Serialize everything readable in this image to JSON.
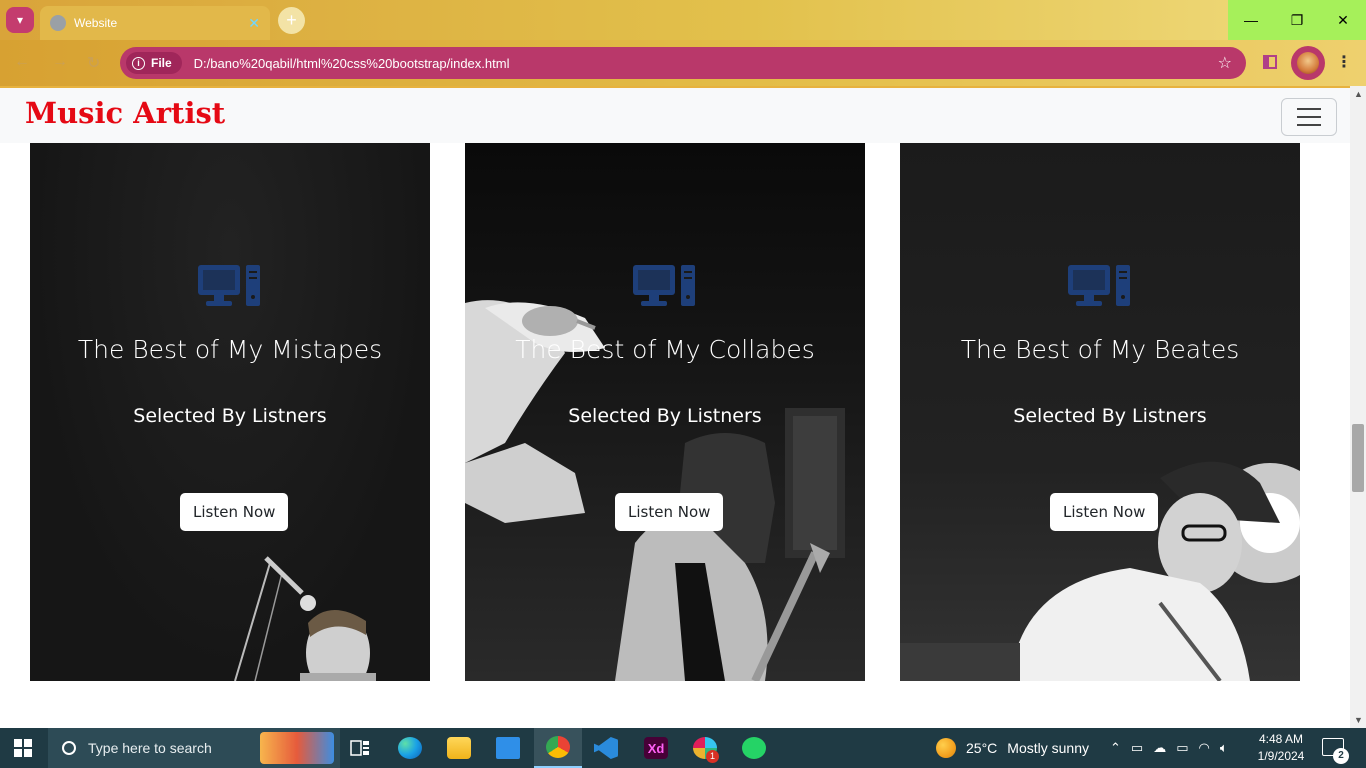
{
  "browser": {
    "tab_title": "Website",
    "tab_close": "✕",
    "new_tab": "+",
    "address_chip": "File",
    "url": "D:/bano%20qabil/html%20css%20bootstrap/index.html",
    "window_controls": {
      "minimize": "—",
      "restore": "❐",
      "close": "✕"
    },
    "nav_icons": [
      "back-icon",
      "forward-icon",
      "reload-icon"
    ],
    "accent_color": "#b9386a"
  },
  "site": {
    "brand": "Music Artist",
    "brand_color": "#e50914",
    "cards": [
      {
        "title": "The Best of My Mistapes",
        "subtitle": "Selected By Listners",
        "button": "Listen Now"
      },
      {
        "title": "The Best of My Collabes",
        "subtitle": "Selected By Listners",
        "button": "Listen Now"
      },
      {
        "title": "The Best of My Beates",
        "subtitle": "Selected By Listners",
        "button": "Listen Now"
      }
    ],
    "icon_color": "#1e3f7a"
  },
  "taskbar": {
    "search_placeholder": "Type here to search",
    "weather_temp": "25°C",
    "weather_text": "Mostly sunny",
    "time": "4:48 AM",
    "date": "1/9/2024",
    "notification_count": "2",
    "chrome_badge": "1",
    "apps": [
      "task-view-icon",
      "edge-icon",
      "file-explorer-icon",
      "mail-icon",
      "chrome-icon",
      "vscode-icon",
      "adobe-xd-icon",
      "slack-icon",
      "whatsapp-icon"
    ]
  }
}
